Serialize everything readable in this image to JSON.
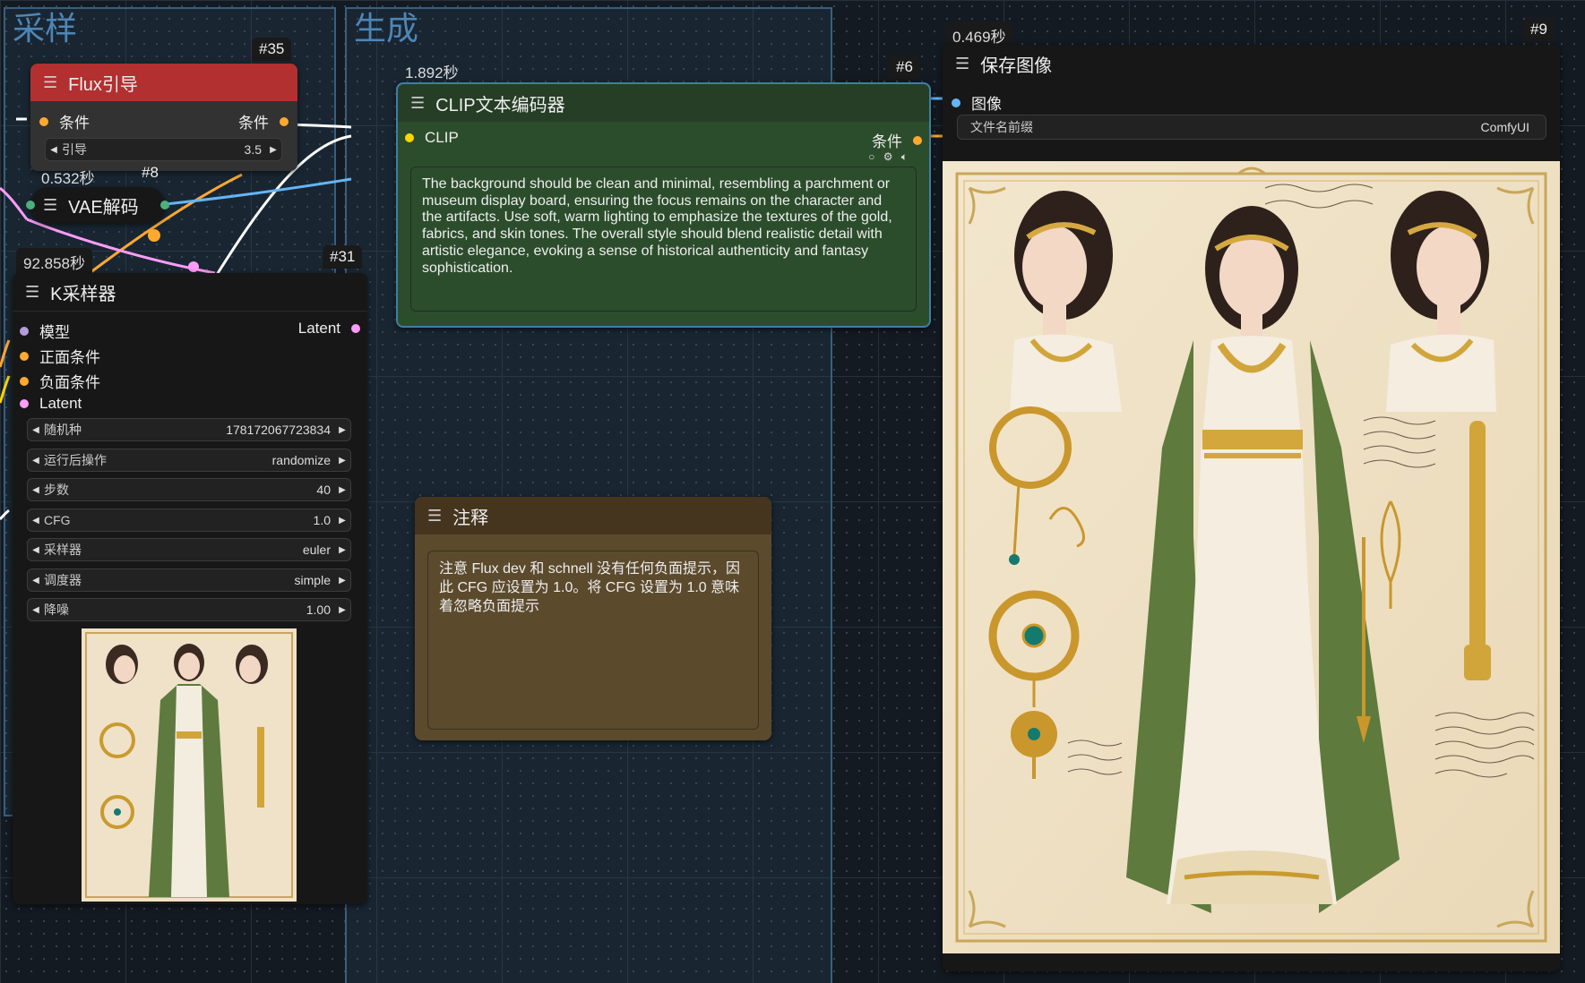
{
  "groups": {
    "sampling": "采样",
    "generate": "生成"
  },
  "nodes": {
    "flux_guidance": {
      "id": "#35",
      "title": "Flux引导",
      "input_label": "条件",
      "output_label": "条件",
      "widget_label": "引导",
      "widget_value": "3.5"
    },
    "vae_decode": {
      "id": "#8",
      "time": "0.532秒",
      "title": "VAE解码"
    },
    "ksampler": {
      "id": "#31",
      "time": "92.858秒",
      "title": "K采样器",
      "inputs": [
        "模型",
        "正面条件",
        "负面条件",
        "Latent"
      ],
      "output_label": "Latent",
      "widgets": [
        {
          "label": "随机种",
          "value": "178172067723834"
        },
        {
          "label": "运行后操作",
          "value": "randomize"
        },
        {
          "label": "步数",
          "value": "40"
        },
        {
          "label": "CFG",
          "value": "1.0"
        },
        {
          "label": "采样器",
          "value": "euler"
        },
        {
          "label": "调度器",
          "value": "simple"
        },
        {
          "label": "降噪",
          "value": "1.00"
        }
      ]
    },
    "clip_encoder": {
      "id": "#6",
      "time": "1.892秒",
      "title": "CLIP文本编码器",
      "input_label": "CLIP",
      "output_label": "条件",
      "text": "The background should be clean and minimal, resembling a parchment or museum display board, ensuring the focus remains on the character and the artifacts. Use soft, warm lighting to emphasize the textures of the gold, fabrics, and skin tones. The overall style should blend realistic detail with artistic elegance, evoking a sense of historical authenticity and fantasy sophistication."
    },
    "note": {
      "title": "注释",
      "text": "注意 Flux dev 和 schnell 没有任何负面提示，因此 CFG 应设置为 1.0。将 CFG 设置为 1.0 意味着忽略负面提示"
    },
    "save_image": {
      "id": "#9",
      "time": "0.469秒",
      "title": "保存图像",
      "input_label": "图像",
      "widget_label": "文件名前缀",
      "widget_value": "ComfyUI"
    }
  },
  "colors": {
    "flux_header": "#b2302f",
    "clip_body": "#2c4d2c",
    "clip_header": "#263d26",
    "clip_border": "#3f7ea6",
    "note_body": "#5c4a2d",
    "note_header": "#45351e",
    "conditioning_dot": "#ffa931",
    "clip_dot": "#ffd500",
    "model_dot": "#b39ddb",
    "latent_dot": "#ff9cf9",
    "image_dot": "#64b5f6",
    "vae_dot": "#4caf7c"
  },
  "icons": [
    "menu-icon",
    "arrow-left-icon",
    "arrow-right-icon",
    "settings-icon",
    "speaker-icon",
    "circle-icon"
  ]
}
